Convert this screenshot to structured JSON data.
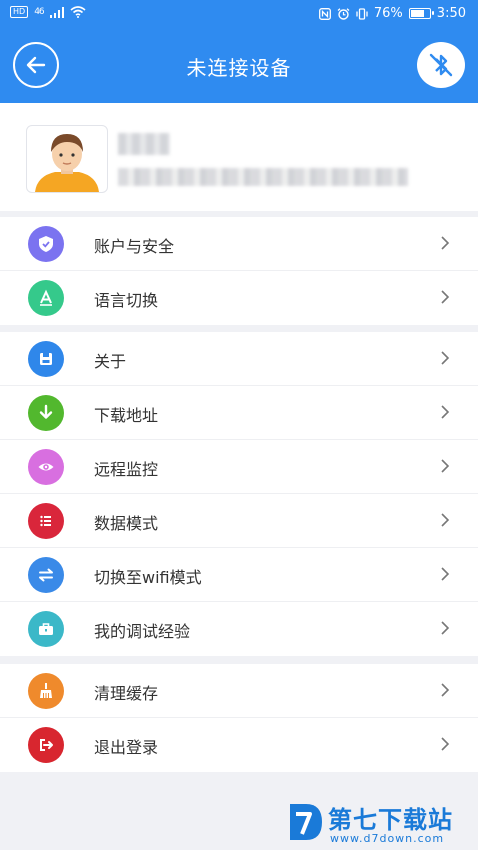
{
  "statusbar": {
    "left_tag": "HD",
    "signal": "46",
    "battery_text": "76%",
    "battery_level": 0.76,
    "time": "3:50"
  },
  "header": {
    "title": "未连接设备",
    "back_icon": "back-arrow-icon",
    "bluetooth_icon": "bluetooth-disabled-icon"
  },
  "menu_groups": [
    [
      {
        "label": "账户与安全",
        "icon": "shield-icon",
        "color": "#7b73f0"
      },
      {
        "label": "语言切换",
        "icon": "language-icon",
        "color": "#35c98b"
      }
    ],
    [
      {
        "label": "关于",
        "icon": "save-icon",
        "color": "#2f87ea"
      },
      {
        "label": "下载地址",
        "icon": "download-icon",
        "color": "#52b82e"
      },
      {
        "label": "远程监控",
        "icon": "eye-icon",
        "color": "#d86fe0"
      },
      {
        "label": "数据模式",
        "icon": "list-icon",
        "color": "#d9263b"
      },
      {
        "label": "切换至wifi模式",
        "icon": "swap-icon",
        "color": "#3a8ae8"
      },
      {
        "label": "我的调试经验",
        "icon": "toolbox-icon",
        "color": "#3bb8c8"
      }
    ],
    [
      {
        "label": "清理缓存",
        "icon": "broom-icon",
        "color": "#ef8a2c"
      },
      {
        "label": "退出登录",
        "icon": "logout-icon",
        "color": "#d8262f"
      }
    ]
  ],
  "watermark": {
    "name": "第七下载站",
    "url": "www.d7down.com"
  }
}
